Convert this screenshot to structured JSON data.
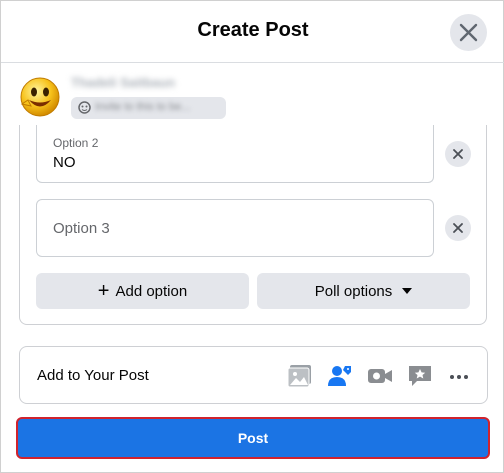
{
  "header": {
    "title": "Create Post"
  },
  "user": {
    "name": "Thadeli Saitbaun",
    "audience": "Invite to this to be..."
  },
  "poll": {
    "options": [
      {
        "label": "Option 2",
        "value": "NO"
      },
      {
        "label": "",
        "placeholder": "Option 3"
      }
    ],
    "add_option_label": "Add option",
    "poll_options_label": "Poll options"
  },
  "add_to_post": {
    "label": "Add to Your Post",
    "tools": [
      "photo-video-icon",
      "tag-people-icon",
      "live-video-icon",
      "feeling-activity-icon",
      "more-icon"
    ]
  },
  "post_button": {
    "label": "Post"
  },
  "colors": {
    "primary": "#1b74e4",
    "highlight_border": "#d0232e",
    "gray_button": "#e4e6eb"
  }
}
